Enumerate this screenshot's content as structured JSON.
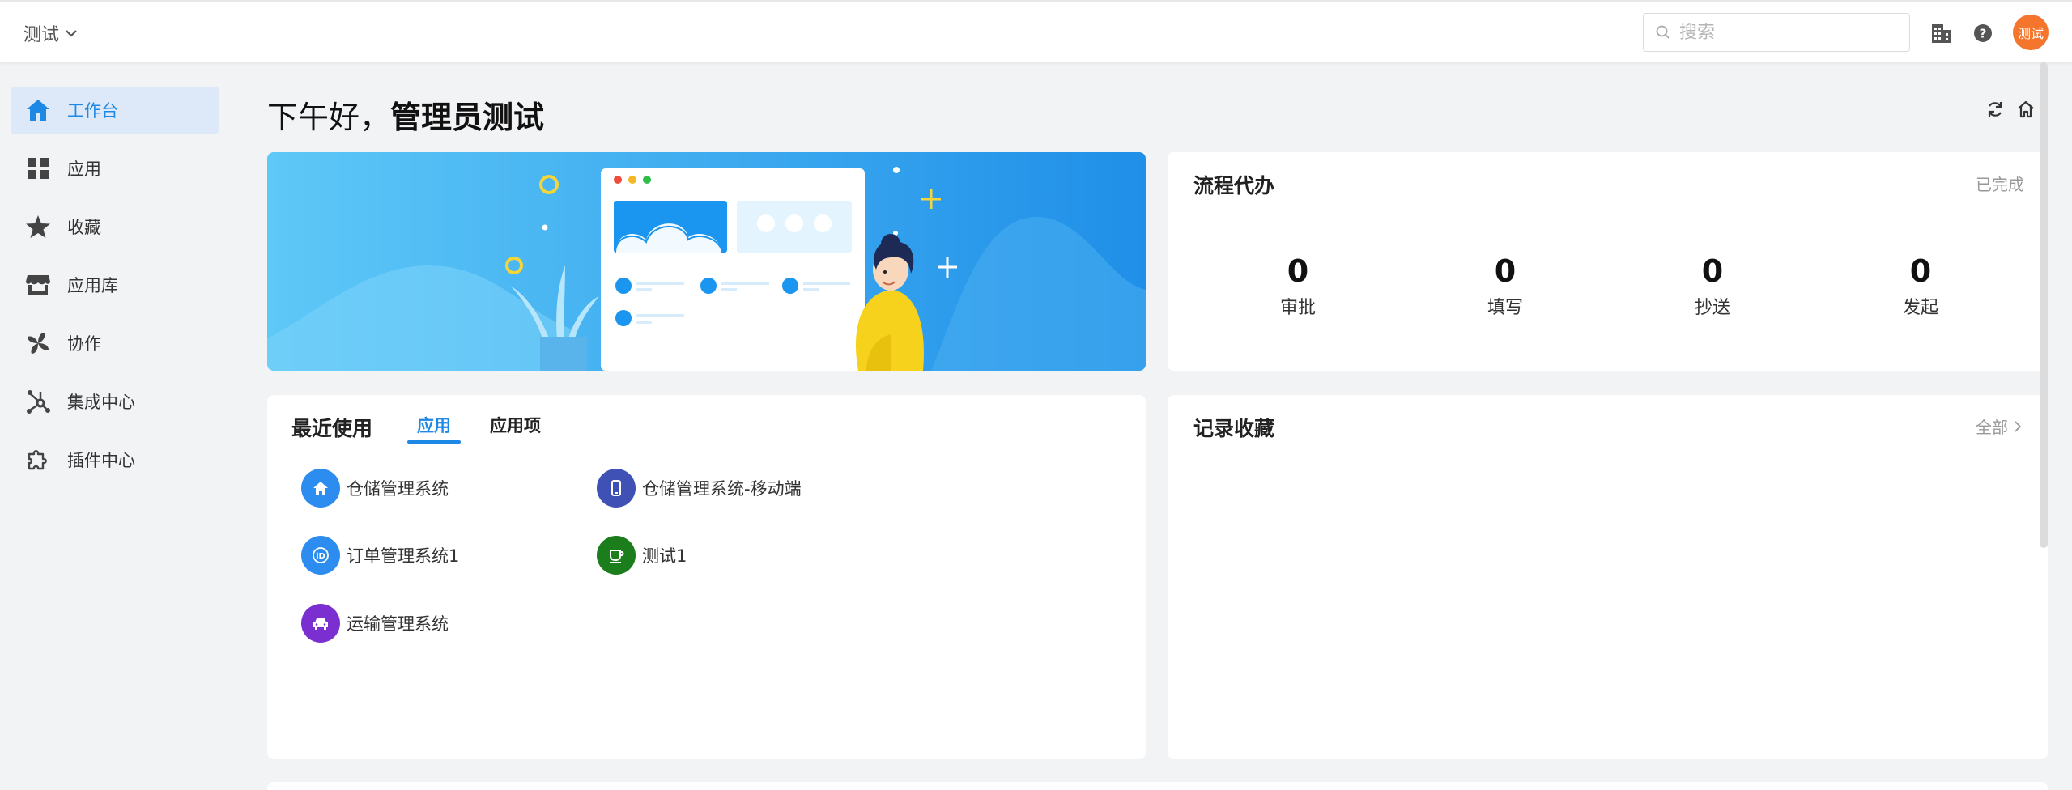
{
  "header": {
    "org_name": "测试",
    "search_placeholder": "搜索",
    "avatar_text": "测试"
  },
  "sidebar": {
    "items": [
      {
        "label": "工作台",
        "icon": "home-icon",
        "active": true
      },
      {
        "label": "应用",
        "icon": "grid-icon"
      },
      {
        "label": "收藏",
        "icon": "star-icon"
      },
      {
        "label": "应用库",
        "icon": "store-icon"
      },
      {
        "label": "协作",
        "icon": "pinwheel-icon"
      },
      {
        "label": "集成中心",
        "icon": "hub-icon"
      },
      {
        "label": "插件中心",
        "icon": "puzzle-icon"
      }
    ]
  },
  "main": {
    "greeting_prefix": "下午好，",
    "greeting_name": "管理员测试"
  },
  "workflow": {
    "title": "流程代办",
    "completed_link": "已完成",
    "stats": [
      {
        "value": "0",
        "label": "审批"
      },
      {
        "value": "0",
        "label": "填写"
      },
      {
        "value": "0",
        "label": "抄送"
      },
      {
        "value": "0",
        "label": "发起"
      }
    ]
  },
  "recent": {
    "title": "最近使用",
    "tabs": [
      "应用",
      "应用项"
    ],
    "apps": [
      {
        "name": "仓储管理系统",
        "icon": "house-icon",
        "color": "#2d8cf0"
      },
      {
        "name": "仓储管理系统-移动端",
        "icon": "mobile-icon",
        "color": "#3f51b5"
      },
      {
        "name": "订单管理系统1",
        "icon": "id-icon",
        "color": "#2d8cf0"
      },
      {
        "name": "测试1",
        "icon": "cup-icon",
        "color": "#1b7d1b"
      },
      {
        "name": "运输管理系统",
        "icon": "car-icon",
        "color": "#7b2fd0"
      }
    ]
  },
  "favorites": {
    "title": "记录收藏",
    "all_link": "全部"
  },
  "colors": {
    "accent": "#1e88e5",
    "avatar": "#f5752d",
    "banner_start": "#5ec8f7",
    "banner_end": "#1f8fe8"
  }
}
